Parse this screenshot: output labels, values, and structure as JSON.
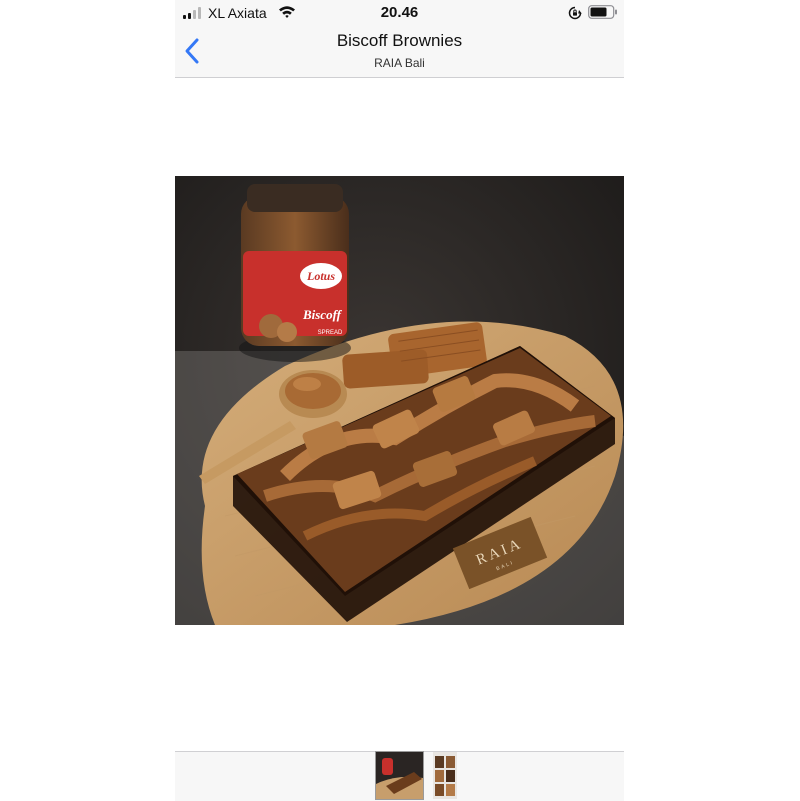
{
  "status_bar": {
    "carrier": "XL Axiata",
    "time": "20.46"
  },
  "nav": {
    "title": "Biscoff Brownies",
    "subtitle": "RAIA Bali"
  },
  "photo": {
    "jar_brand": "Lotus",
    "jar_product": "Biscoff",
    "jar_label": "SPREAD",
    "board_logo": "RAIA",
    "board_logo_sub": "BALI"
  },
  "colors": {
    "accent": "#3478f6",
    "bar_background": "#f7f7f7"
  },
  "thumbnails": {
    "count": 2,
    "selected_index": 0
  }
}
